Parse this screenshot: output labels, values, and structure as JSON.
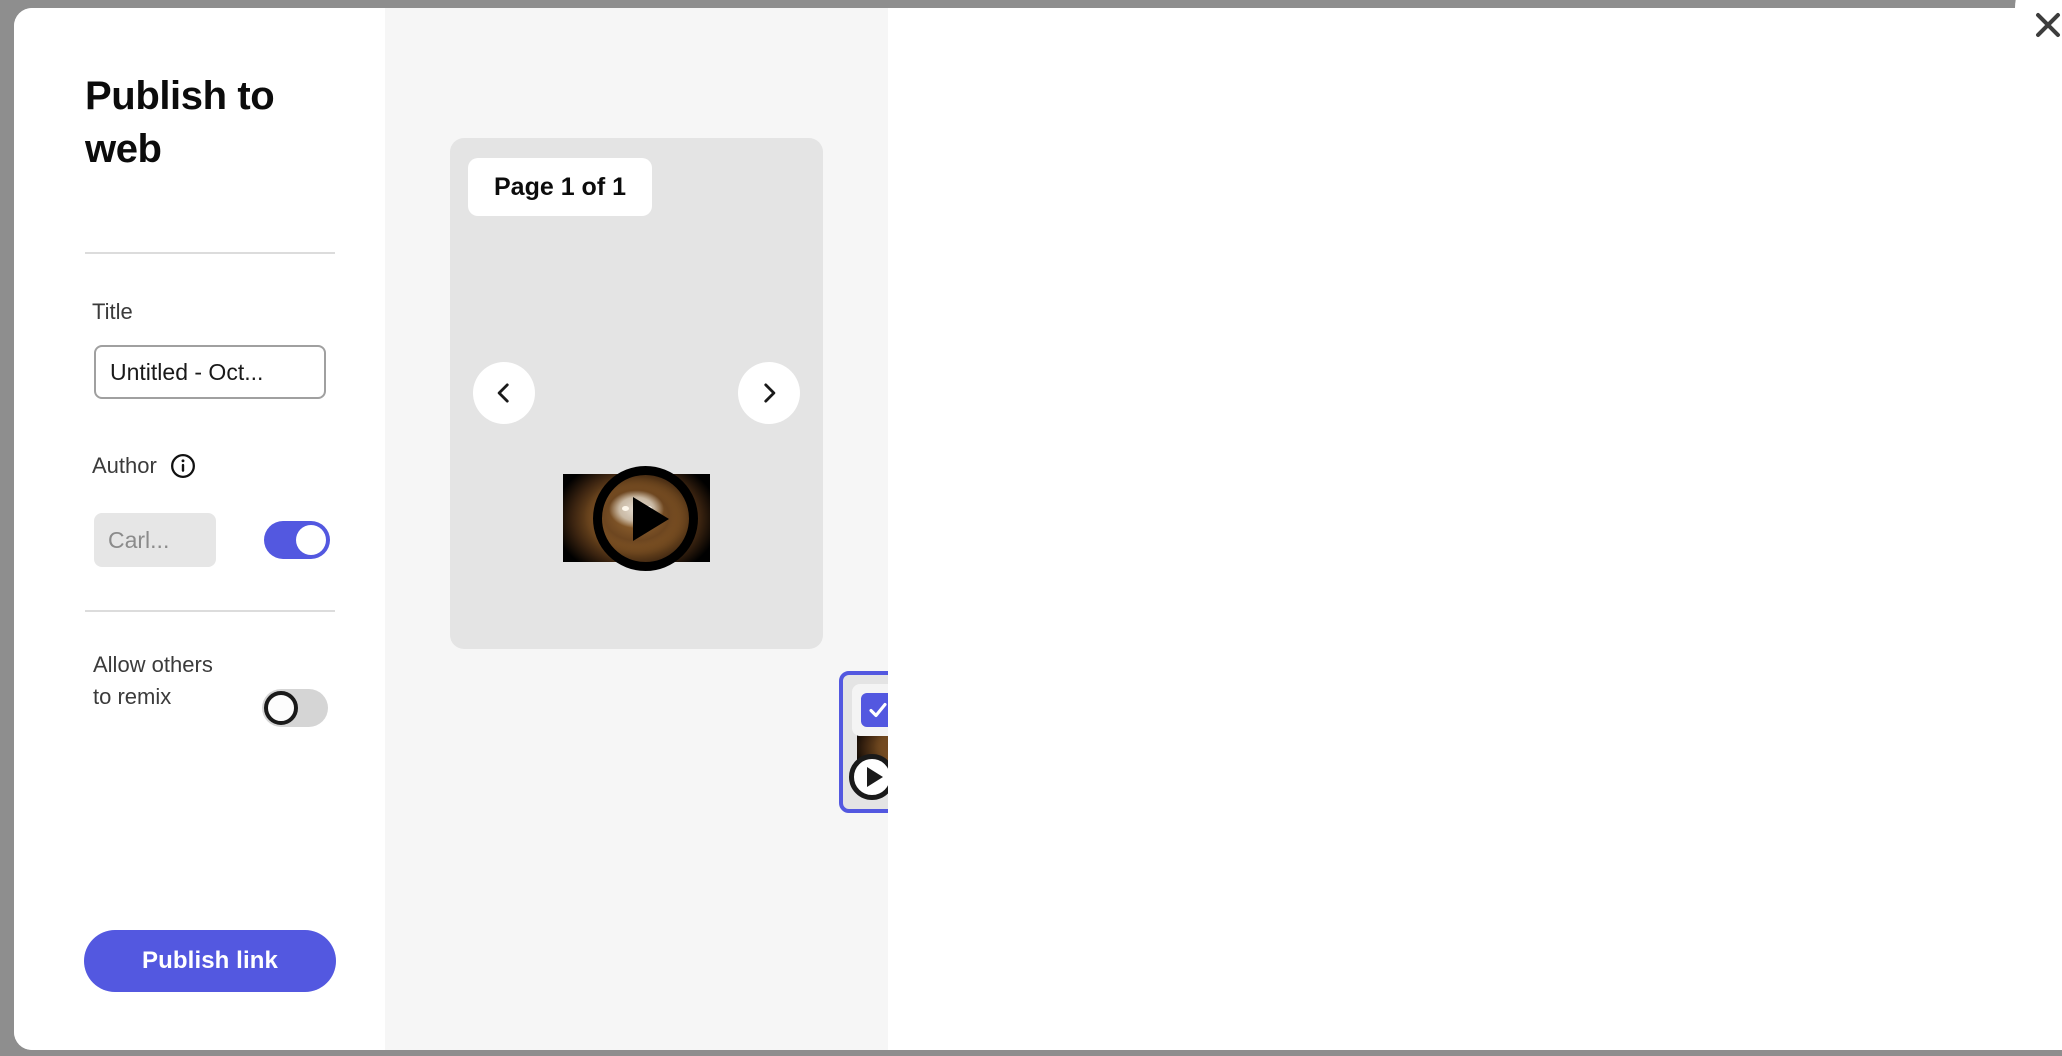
{
  "dialog": {
    "title": "Publish to web",
    "close_label": "Close"
  },
  "form": {
    "title_label": "Title",
    "title_value": "Untitled - Oct...",
    "title_placeholder": "Untitled - Oct...",
    "author_label": "Author",
    "author_info_icon": "info-icon",
    "author_value": "Carl...",
    "author_placeholder": "Carl...",
    "author_toggle_state": "on",
    "remix_label": "Allow others to remix",
    "remix_toggle_state": "off",
    "publish_label": "Publish link"
  },
  "preview": {
    "page_indicator": "Page 1 of 1",
    "prev_label": "Previous page",
    "next_label": "Next page",
    "play_label": "Play video",
    "media_alt": "lion video",
    "thumbnail": {
      "selected": true,
      "checkbox_label": "Selected",
      "play_label": "Play thumbnail video"
    }
  },
  "colors": {
    "accent": "#5358e0",
    "panel_bg": "#f6f6f6",
    "card_bg": "#e4e4e4",
    "divider": "#dcdcdc",
    "toggle_off_track": "#d5d5d5",
    "page_bg": "#8e8e8e"
  }
}
